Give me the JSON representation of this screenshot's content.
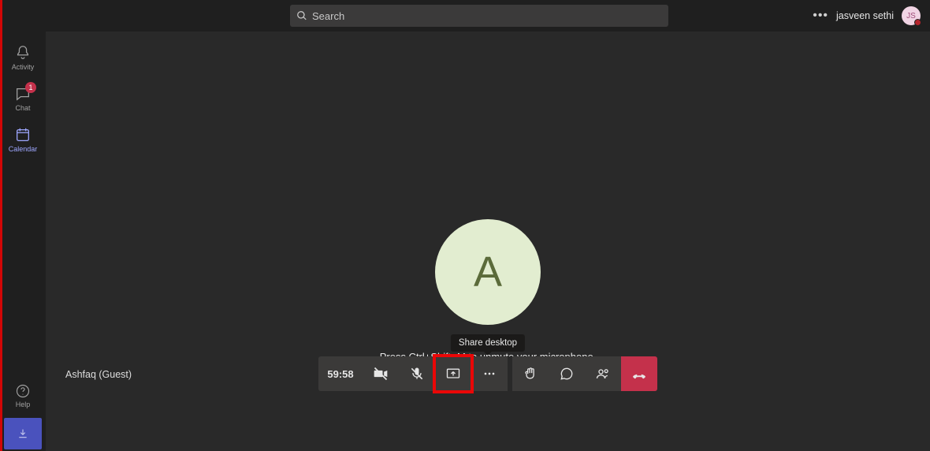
{
  "search": {
    "placeholder": "Search"
  },
  "user": {
    "name": "jasveen sethi",
    "initials": "JS"
  },
  "nav": {
    "activity": "Activity",
    "chat": "Chat",
    "chat_badge": "1",
    "calendar": "Calendar",
    "help": "Help"
  },
  "meeting": {
    "remote_initial": "A",
    "remote_name": "Ashfaq (Guest)",
    "tooltip": "Share desktop",
    "hint": "Press Ctrl+Shift+M to unmute your microphone.",
    "timer": "59:58"
  }
}
